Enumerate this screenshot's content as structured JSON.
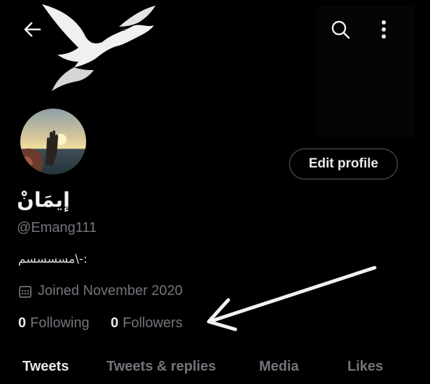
{
  "profile": {
    "display_name": "إيمَانْ",
    "handle": "@Emang111",
    "bio": "مسسسسم\\-:",
    "joined": "Joined November 2020",
    "following_count": "0",
    "following_label": "Following",
    "followers_count": "0",
    "followers_label": "Followers"
  },
  "header": {
    "back_icon": "arrow-left-icon",
    "search_icon": "search-icon",
    "more_icon": "more-vertical-icon"
  },
  "actions": {
    "edit_profile_label": "Edit profile"
  },
  "tabs": [
    {
      "label": "Tweets",
      "active": true
    },
    {
      "label": "Tweets & replies",
      "active": false
    },
    {
      "label": "Media",
      "active": false
    },
    {
      "label": "Likes",
      "active": false
    }
  ],
  "colors": {
    "background": "#000000",
    "text": "#e7e9ea",
    "secondary": "#71767b",
    "border": "#5b6168"
  }
}
